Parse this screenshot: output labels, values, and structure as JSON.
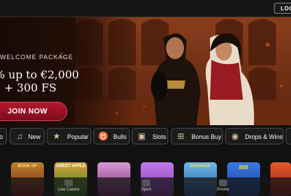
{
  "header": {
    "login_label": "LOG"
  },
  "banner": {
    "eyebrow": "WELCOME PACKAGE",
    "headline_line1": "% up to €2,000",
    "headline_line2": "+ 300 FS",
    "cta_label": "JOIN NOW",
    "slide_count": 2,
    "active_slide": 1
  },
  "categories": [
    {
      "label": "o",
      "icon": "lobby-icon"
    },
    {
      "label": "New",
      "icon": "bell-icon"
    },
    {
      "label": "Popular",
      "icon": "star-icon"
    },
    {
      "label": "Bulls",
      "icon": "bull-icon"
    },
    {
      "label": "Slots",
      "icon": "slot-machine-icon"
    },
    {
      "label": "Bonus Buy",
      "icon": "gift-icon"
    },
    {
      "label": "Drops & Wins",
      "icon": "coins-icon"
    }
  ],
  "games": [
    {
      "caption": "BOOK OF",
      "color": "#7a1a1a"
    },
    {
      "caption": "SWEET APPLE",
      "color": "#2f7a2a"
    },
    {
      "caption": "",
      "color": "#7a2a6a"
    },
    {
      "caption": "",
      "color": "#8a3ab0"
    },
    {
      "caption": "BONANZA",
      "color": "#2a5aa0"
    },
    {
      "caption": "888",
      "color": "#1a3a8a"
    },
    {
      "caption": "",
      "color": "#8a1a1a"
    }
  ],
  "bottom_nav": [
    {
      "label": "Live Casino"
    },
    {
      "label": "Sport"
    },
    {
      "label": "Promo"
    }
  ]
}
